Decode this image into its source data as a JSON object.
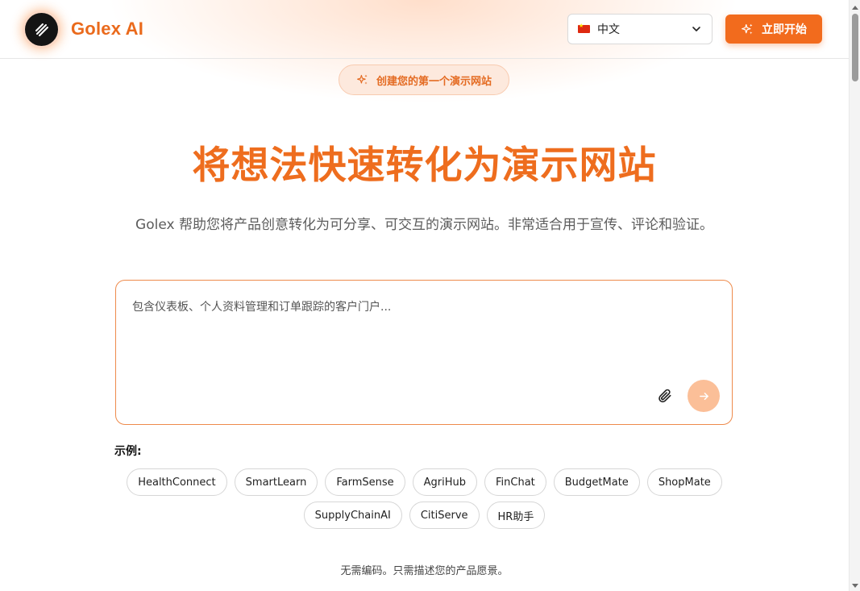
{
  "header": {
    "brand": "Golex AI",
    "language": {
      "flag": "cn-flag-icon",
      "selected": "中文"
    },
    "start_button": "立即开始"
  },
  "hero": {
    "pill": "创建您的第一个演示网站",
    "title": "将想法快速转化为演示网站",
    "subtitle": "Golex 帮助您将产品创意转化为可分享、可交互的演示网站。非常适合用于宣传、评论和验证。"
  },
  "prompt": {
    "placeholder": "包含仪表板、个人资料管理和订单跟踪的客户门户...",
    "value": ""
  },
  "examples": {
    "label": "示例:",
    "items": [
      "HealthConnect",
      "SmartLearn",
      "FarmSense",
      "AgriHub",
      "FinChat",
      "BudgetMate",
      "ShopMate",
      "SupplyChainAI",
      "CitiServe",
      "HR助手"
    ]
  },
  "footer_note": "无需编码。只需描述您的产品愿景。",
  "colors": {
    "accent": "#f26b1d",
    "title": "#ee6d1e",
    "send_button": "#fbbf98",
    "pill_bg": "#fde9dd"
  }
}
